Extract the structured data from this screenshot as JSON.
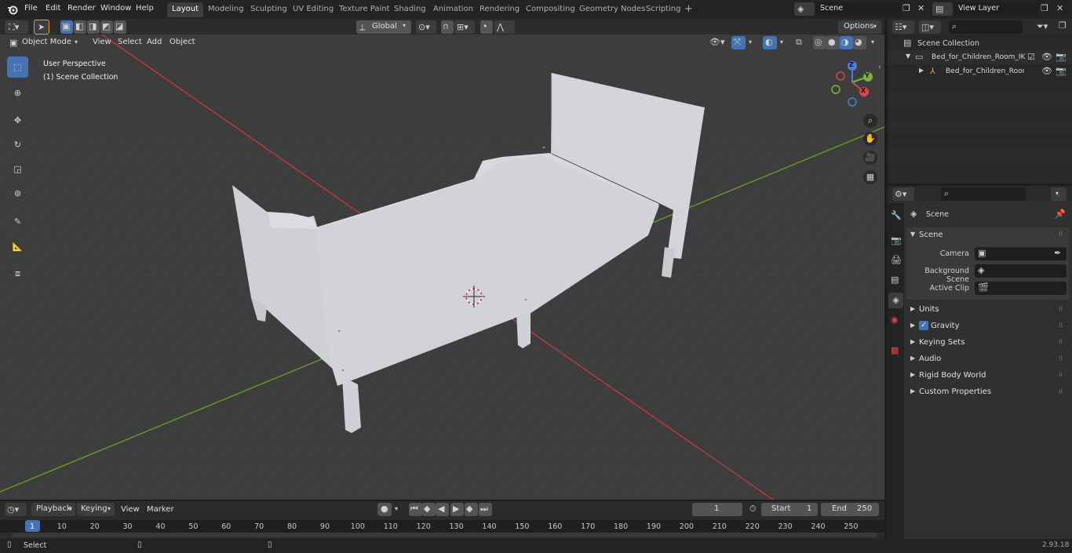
{
  "menu": [
    "File",
    "Edit",
    "Render",
    "Window",
    "Help"
  ],
  "workspaces": [
    {
      "label": "Layout",
      "active": true
    },
    {
      "label": "Modeling"
    },
    {
      "label": "Sculpting"
    },
    {
      "label": "UV Editing"
    },
    {
      "label": "Texture Paint"
    },
    {
      "label": "Shading"
    },
    {
      "label": "Animation"
    },
    {
      "label": "Rendering"
    },
    {
      "label": "Compositing"
    },
    {
      "label": "Geometry Nodes"
    },
    {
      "label": "Scripting"
    }
  ],
  "add_workspace": "+",
  "scene_field": "Scene",
  "view_layer_field": "View Layer",
  "tool_header": {
    "orientation": "Global",
    "options": "Options"
  },
  "viewport_header": {
    "mode": "Object Mode",
    "view": "View",
    "select": "Select",
    "add": "Add",
    "object": "Object"
  },
  "viewport": {
    "perspective": "User Perspective",
    "collection": "(1) Scene Collection"
  },
  "gizmo": {
    "z": "Z",
    "y": "Y",
    "x": "X"
  },
  "toolbar_icons": [
    "select-box-icon",
    "cursor-icon",
    "move-icon",
    "rotate-icon",
    "scale-icon",
    "transform-icon",
    "annotate-icon",
    "measure-icon",
    "add-cube-icon"
  ],
  "outliner": {
    "root": "Scene Collection",
    "items": [
      {
        "label": "Bed_for_Children_Room_IKEA",
        "level": 1
      },
      {
        "label": "Bed_for_Children_Room_",
        "level": 2
      }
    ]
  },
  "properties": {
    "context": "Scene",
    "panel": "Scene",
    "fields": [
      {
        "label": "Camera"
      },
      {
        "label": "Background Scene"
      },
      {
        "label": "Active Clip"
      }
    ],
    "subpanels": [
      "Units",
      "Gravity",
      "Keying Sets",
      "Audio",
      "Rigid Body World",
      "Custom Properties"
    ],
    "gravity_checked": true
  },
  "timeline": {
    "playback": "Playback",
    "keying": "Keying",
    "view": "View",
    "marker": "Marker",
    "current_frame": "1",
    "start_label": "Start",
    "start": "1",
    "end_label": "End",
    "end": "250",
    "ticks": [
      "1",
      "10",
      "20",
      "30",
      "40",
      "50",
      "60",
      "70",
      "80",
      "90",
      "100",
      "110",
      "120",
      "130",
      "140",
      "150",
      "160",
      "170",
      "180",
      "190",
      "200",
      "210",
      "220",
      "230",
      "240",
      "250"
    ]
  },
  "status": {
    "select": "Select",
    "version": "2.93.18"
  },
  "colors": {
    "accent": "#4772b3",
    "x_axis": "#c0393b",
    "y_axis": "#6a9a2b",
    "viewport_bg": "#3d3d3d",
    "model": "#d8d9dd"
  }
}
